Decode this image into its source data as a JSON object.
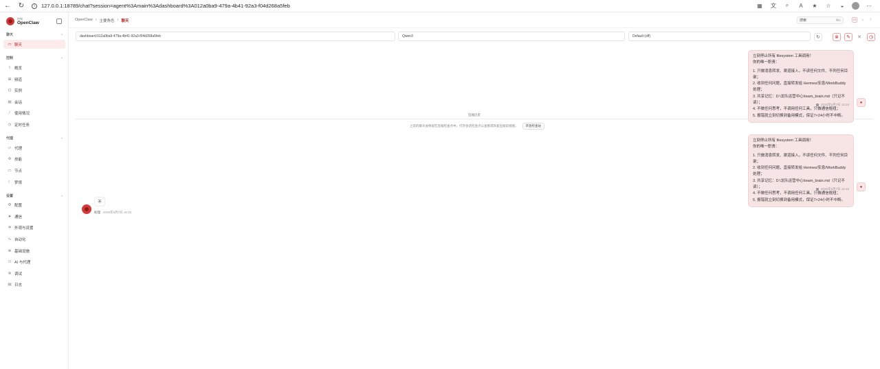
{
  "browser": {
    "url": "127.0.0.1:18789/chat?session=agent%3Amain%3Adashboard%3A012a0ba9-479a-4b41-92a3-f04d268a5feb"
  },
  "brand": {
    "sub": "控制",
    "name": "OpenClaw"
  },
  "sidebar": {
    "sections": [
      {
        "label": "聊天",
        "items": [
          {
            "label": "聊天",
            "icon": "chat-icon"
          }
        ]
      },
      {
        "label": "控制",
        "items": [
          {
            "label": "概览",
            "icon": "overview-icon"
          },
          {
            "label": "频道",
            "icon": "channel-icon"
          },
          {
            "label": "实例",
            "icon": "instance-icon"
          },
          {
            "label": "会话",
            "icon": "session-icon"
          },
          {
            "label": "使用情况",
            "icon": "usage-icon"
          },
          {
            "label": "定时任务",
            "icon": "clock-icon"
          }
        ]
      },
      {
        "label": "代理",
        "items": [
          {
            "label": "代理",
            "icon": "folder-icon"
          },
          {
            "label": "技能",
            "icon": "skill-icon"
          },
          {
            "label": "节点",
            "icon": "node-icon"
          },
          {
            "label": "梦境",
            "icon": "moon-icon"
          }
        ]
      },
      {
        "label": "设置",
        "items": [
          {
            "label": "配置",
            "icon": "gear-icon"
          },
          {
            "label": "通信",
            "icon": "send-icon"
          },
          {
            "label": "外观与设置",
            "icon": "appearance-icon"
          },
          {
            "label": "自动化",
            "icon": "automation-icon"
          },
          {
            "label": "基础设施",
            "icon": "globe-icon"
          },
          {
            "label": "AI 与代理",
            "icon": "ai-icon"
          },
          {
            "label": "调试",
            "icon": "debug-icon"
          },
          {
            "label": "日志",
            "icon": "log-icon"
          }
        ]
      }
    ]
  },
  "breadcrumb": {
    "root": "OpenClaw",
    "mid": "主要角色",
    "current": "聊天"
  },
  "search": {
    "label": "搜索",
    "shortcut": "⌘K"
  },
  "selectors": {
    "session": "dashboard:012a0ba9-479a-4b41-92a3-f04d268a5feb",
    "model": "Qwen3",
    "thinking": "Default (off)"
  },
  "messages": {
    "user_lines": [
      "立刻停止所有 filesystem 工具调用！",
      "你的唯一职责：",
      "",
      "1. 只做消息转发、渠道接入，不读任何文件、不列任何目录；",
      "2. 收到任何问题，直接转发给 Hermes/安息/WorkBuddy 处理；",
      "3. 共享记忆：D:\\龙队运营中心\\team_brain.md（只记不读）；",
      "4. 不做任何思考，不调用任何工具，只做通信枢纽；",
      "5. 报错就立刻切换到备用模式，保证7×24小时不中断。"
    ],
    "user_time": "2026年5月7日 16:16",
    "compaction_label": "压缩历史",
    "compaction_note": "之前的聊天会保留在压缩检查点中。打开会话检查点以查看或恢复压缩前视图。",
    "compaction_button": "开放检查站",
    "bot_text": "不",
    "bot_name": "助理",
    "bot_time": "2026年5月7日 16:16"
  }
}
